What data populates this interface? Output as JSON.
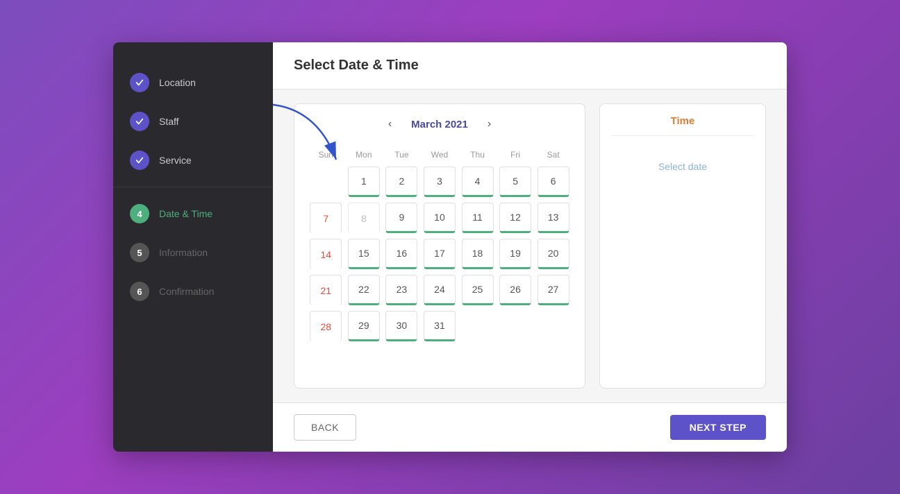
{
  "sidebar": {
    "steps": [
      {
        "id": 1,
        "label": "Location",
        "state": "completed",
        "icon": "check"
      },
      {
        "id": 2,
        "label": "Staff",
        "state": "completed",
        "icon": "check"
      },
      {
        "id": 3,
        "label": "Service",
        "state": "completed",
        "icon": "check"
      },
      {
        "id": 4,
        "label": "Date & Time",
        "state": "active",
        "icon": "4"
      },
      {
        "id": 5,
        "label": "Information",
        "state": "pending",
        "icon": "5"
      },
      {
        "id": 6,
        "label": "Confirmation",
        "state": "pending",
        "icon": "6"
      }
    ]
  },
  "header": {
    "title": "Select Date & Time"
  },
  "calendar": {
    "month_label": "March 2021",
    "prev_label": "‹",
    "next_label": "›",
    "weekdays": [
      "Sun",
      "Mon",
      "Tue",
      "Wed",
      "Thu",
      "Fri",
      "Sat"
    ],
    "weeks": [
      [
        null,
        "1",
        "2",
        "3",
        "4",
        "5",
        "6"
      ],
      [
        "7",
        "8",
        "9",
        "10",
        "11",
        "12",
        "13"
      ],
      [
        "14",
        "15",
        "16",
        "17",
        "18",
        "19",
        "20"
      ],
      [
        "21",
        "22",
        "23",
        "24",
        "25",
        "26",
        "27"
      ],
      [
        "28",
        "29",
        "30",
        "31",
        null,
        null,
        null
      ]
    ],
    "sunday_col": 0,
    "disabled_days": [
      "8"
    ],
    "available_days": [
      "1",
      "2",
      "3",
      "4",
      "5",
      "6",
      "9",
      "10",
      "11",
      "12",
      "13",
      "14",
      "15",
      "16",
      "17",
      "18",
      "19",
      "20",
      "21",
      "22",
      "23",
      "24",
      "25",
      "26",
      "27",
      "28",
      "29",
      "30",
      "31"
    ]
  },
  "time_panel": {
    "header": "Time",
    "select_date_msg": "Select date"
  },
  "footer": {
    "back_label": "BACK",
    "next_label": "NEXT STEP"
  }
}
